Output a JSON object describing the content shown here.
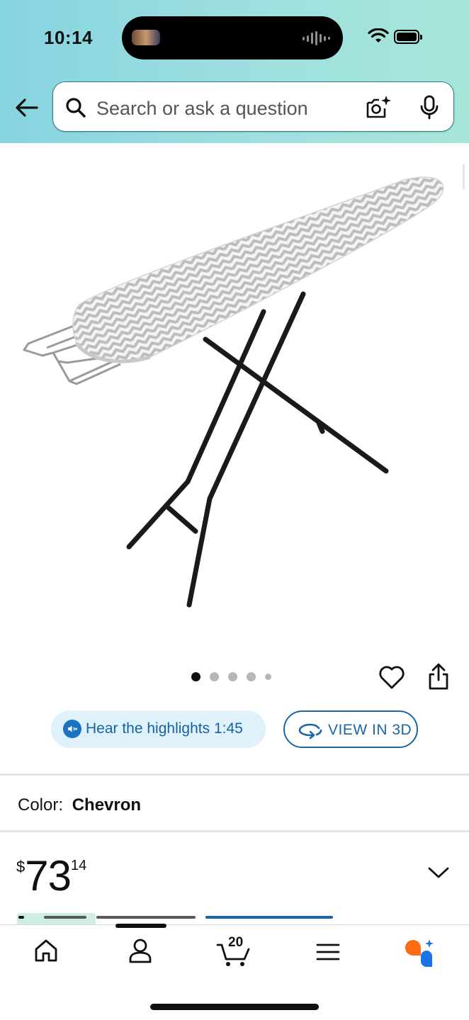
{
  "status_bar": {
    "time": "10:14"
  },
  "header": {
    "search": {
      "placeholder": "Search or ask a question"
    },
    "icons": {
      "back": "arrow-left-icon",
      "search": "search-icon",
      "camera": "camera-lens-icon",
      "mic": "microphone-icon"
    }
  },
  "product": {
    "image_alt": "ironing board",
    "gallery": {
      "total_images": 5,
      "active_index": 0
    },
    "actions": {
      "hear_highlights": "Hear the highlights 1:45",
      "view_3d": "VIEW IN 3D"
    },
    "color": {
      "label": "Color:",
      "value": "Chevron"
    },
    "price": {
      "symbol": "$",
      "whole": "73",
      "fraction": "14"
    }
  },
  "bottom_nav": {
    "items": [
      {
        "name": "home",
        "icon": "home-icon"
      },
      {
        "name": "account",
        "icon": "user-icon"
      },
      {
        "name": "cart",
        "icon": "cart-icon",
        "count": "20"
      },
      {
        "name": "menu",
        "icon": "menu-icon"
      },
      {
        "name": "rufus",
        "icon": "assistant-icon"
      }
    ]
  },
  "colors": {
    "header_start": "#86d4e0",
    "header_end": "#a6e6d8",
    "link_blue": "#1866a8",
    "assistant_orange": "#ff6a13",
    "assistant_blue": "#1a73e8"
  }
}
